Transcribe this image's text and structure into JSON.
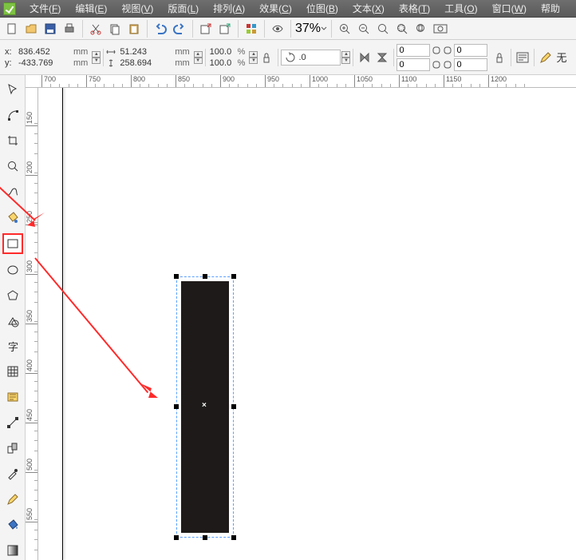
{
  "menu": {
    "items": [
      {
        "label": "文件",
        "hot": "F"
      },
      {
        "label": "编辑",
        "hot": "E"
      },
      {
        "label": "视图",
        "hot": "V"
      },
      {
        "label": "版面",
        "hot": "L"
      },
      {
        "label": "排列",
        "hot": "A"
      },
      {
        "label": "效果",
        "hot": "C"
      },
      {
        "label": "位图",
        "hot": "B"
      },
      {
        "label": "文本",
        "hot": "X"
      },
      {
        "label": "表格",
        "hot": "T"
      },
      {
        "label": "工具",
        "hot": "O"
      },
      {
        "label": "窗口",
        "hot": "W"
      },
      {
        "label": "帮助"
      }
    ]
  },
  "std": {
    "zoom": "37%"
  },
  "prop": {
    "x_label": "x:",
    "x": "836.452",
    "x_unit": "mm",
    "y_label": "y:",
    "y": "-433.769",
    "y_unit": "mm",
    "w": "51.243",
    "w_unit": "mm",
    "h": "258.694",
    "h_unit": "mm",
    "scale_x": "100.0",
    "scale_y": "100.0",
    "scale_unit": "%",
    "rotate": ".0",
    "fill_label": "无"
  },
  "ruler_h": [
    700,
    750,
    800,
    850,
    900,
    950,
    1000,
    1050,
    1100,
    1150,
    1200
  ],
  "ruler_v": [
    150,
    200,
    250,
    300,
    350,
    400,
    450,
    500,
    550
  ]
}
